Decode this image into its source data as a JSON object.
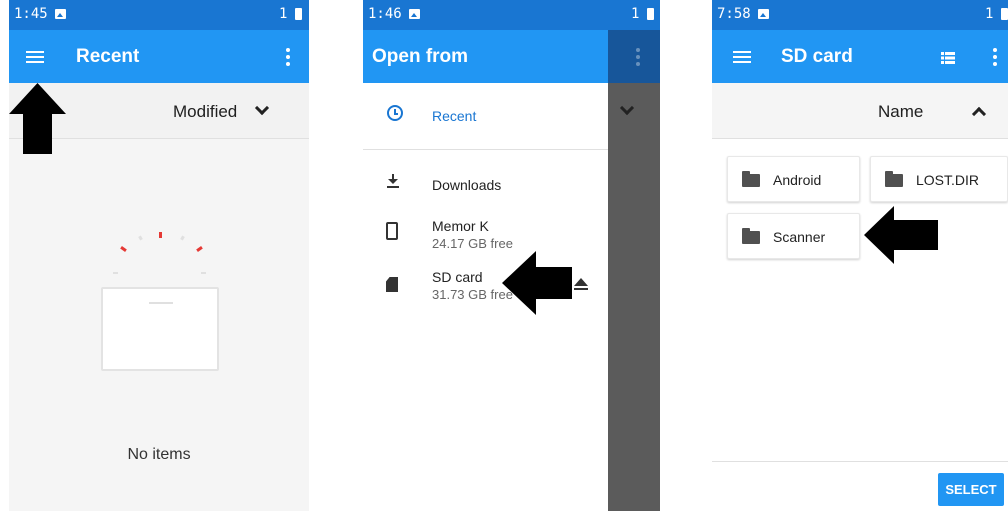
{
  "screen1": {
    "status": {
      "time": "1:45",
      "sim": "1"
    },
    "appbar": {
      "title": "Recent"
    },
    "sort": {
      "label": "Modified"
    },
    "empty": {
      "message": "No items"
    }
  },
  "screen2": {
    "status": {
      "time": "1:46",
      "sim": "1"
    },
    "drawer": {
      "title": "Open from",
      "items": [
        {
          "label": "Recent",
          "icon": "clock-icon",
          "active": true
        },
        {
          "label": "Downloads",
          "icon": "download-icon"
        },
        {
          "label": "Memor K",
          "sub": "24.17 GB free",
          "icon": "phone-icon"
        },
        {
          "label": "SD card",
          "sub": "31.73 GB free",
          "icon": "sd-card-icon"
        }
      ]
    }
  },
  "screen3": {
    "status": {
      "time": "7:58",
      "sim": "1"
    },
    "appbar": {
      "title": "SD card"
    },
    "sort": {
      "label": "Name"
    },
    "folders": [
      "Android",
      "LOST.DIR",
      "Scanner"
    ],
    "select_label": "SELECT"
  },
  "colors": {
    "appbar": "#2196f3",
    "statusbar": "#1976d2",
    "accent": "#1976d2",
    "arrow": "#000000"
  }
}
